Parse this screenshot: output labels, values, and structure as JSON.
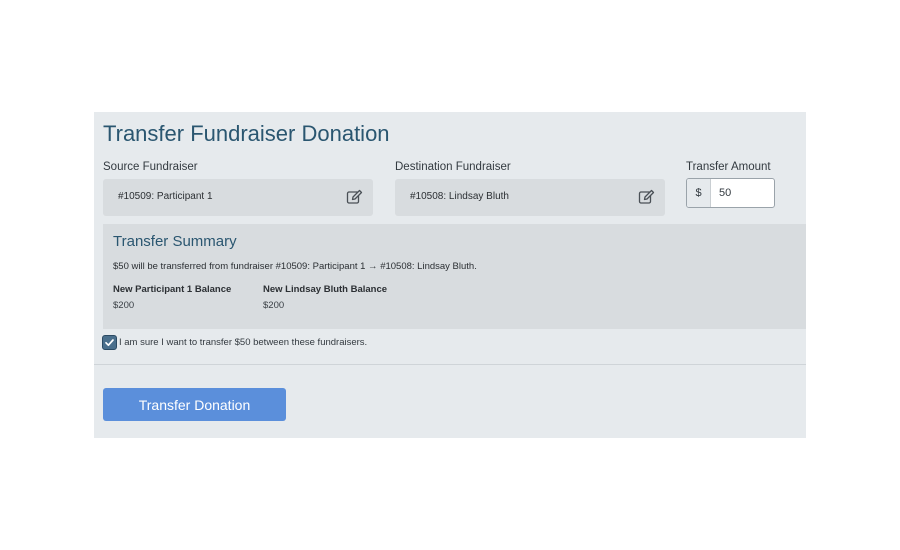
{
  "page": {
    "title": "Transfer Fundraiser Donation"
  },
  "source": {
    "label": "Source Fundraiser",
    "value": "#10509: Participant 1"
  },
  "destination": {
    "label": "Destination Fundraiser",
    "value": "#10508: Lindsay Bluth"
  },
  "amount": {
    "label": "Transfer Amount",
    "currency_symbol": "$",
    "value": "50"
  },
  "summary": {
    "title": "Transfer Summary",
    "text": "$50 will be transferred from fundraiser #10509: Participant 1 → #10508: Lindsay Bluth.",
    "balances": [
      {
        "label": "New Participant 1 Balance",
        "value": "$200"
      },
      {
        "label": "New Lindsay Bluth Balance",
        "value": "$200"
      }
    ]
  },
  "confirm": {
    "checked": true,
    "text": "I am sure I want to transfer $50 between these fundraisers."
  },
  "submit": {
    "label": "Transfer Donation"
  },
  "icons": {
    "edit": "edit-icon",
    "check": "checkmark-icon"
  },
  "colors": {
    "heading": "#2a5670",
    "button": "#5b8fdb",
    "checkbox": "#4a6f8c"
  }
}
